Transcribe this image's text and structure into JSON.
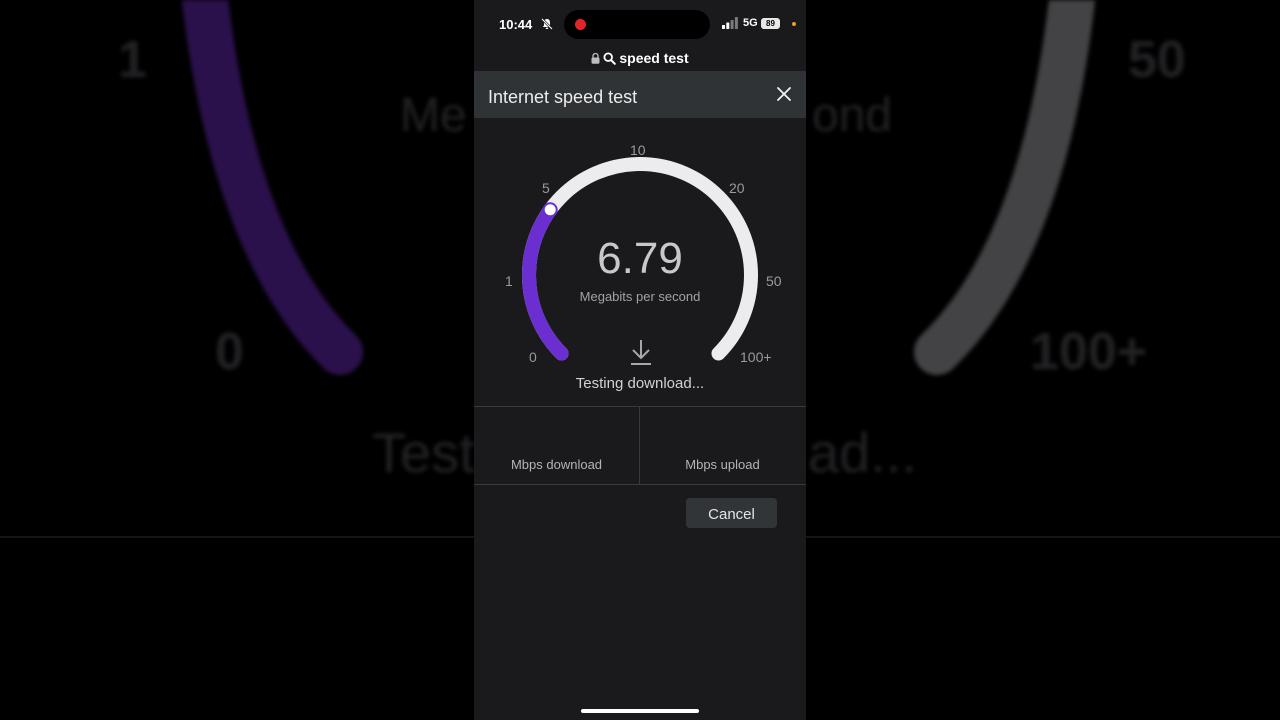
{
  "background": {
    "left_tick_1": "1",
    "left_tick_0": "0",
    "right_tick_50": "50",
    "right_tick_100": "100+",
    "subtitle_fragment_left": "Me",
    "subtitle_fragment_right": "ond",
    "status_fragment_left": "Test",
    "status_fragment_right": "ad..."
  },
  "status_bar": {
    "time": "10:44",
    "network": "5G",
    "battery": "89",
    "recording_color": "#e3242b",
    "privacy_dot_color": "#f39a1c"
  },
  "url_bar": {
    "text": "speed test"
  },
  "panel": {
    "title": "Internet speed test",
    "close_icon": "close-icon"
  },
  "gauge": {
    "value": "6.79",
    "unit": "Megabits per second",
    "ticks": [
      "0",
      "1",
      "5",
      "10",
      "20",
      "50",
      "100+"
    ],
    "accent_color": "#6a2ed1",
    "track_color": "#ececee",
    "progress_fraction": 0.3,
    "status": "Testing download..."
  },
  "results": {
    "download_label": "Mbps download",
    "upload_label": "Mbps upload"
  },
  "actions": {
    "cancel_label": "Cancel"
  }
}
